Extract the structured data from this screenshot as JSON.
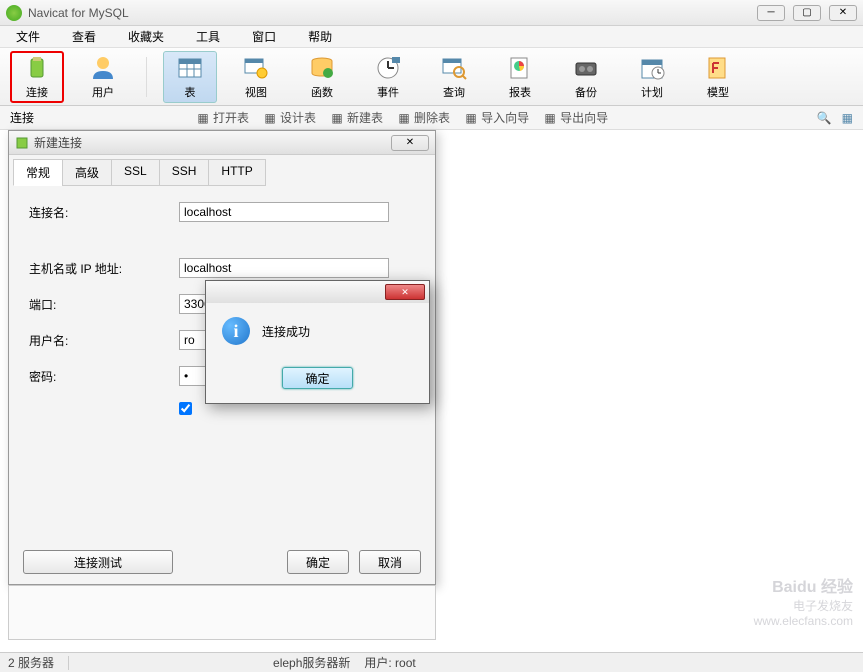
{
  "window": {
    "title": "Navicat for MySQL"
  },
  "menu": {
    "file": "文件",
    "view": "查看",
    "favorites": "收藏夹",
    "tools": "工具",
    "window": "窗口",
    "help": "帮助"
  },
  "toolbar": {
    "connection": "连接",
    "user": "用户",
    "table": "表",
    "view": "视图",
    "function": "函数",
    "event": "事件",
    "query": "查询",
    "report": "报表",
    "backup": "备份",
    "schedule": "计划",
    "model": "模型"
  },
  "secondbar": {
    "connection_label": "连接",
    "open_table": "打开表",
    "design_table": "设计表",
    "new_table": "新建表",
    "delete_table": "删除表",
    "import_wizard": "导入向导",
    "export_wizard": "导出向导"
  },
  "dialog": {
    "title": "新建连接",
    "tabs": {
      "general": "常规",
      "advanced": "高级",
      "ssl": "SSL",
      "ssh": "SSH",
      "http": "HTTP"
    },
    "fields": {
      "conn_name_label": "连接名:",
      "conn_name_value": "localhost",
      "host_label": "主机名或 IP 地址:",
      "host_value": "localhost",
      "port_label": "端口:",
      "port_value": "3306",
      "user_label": "用户名:",
      "user_value": "ro",
      "password_label": "密码:",
      "password_value": "•"
    },
    "buttons": {
      "test": "连接测试",
      "ok": "确定",
      "cancel": "取消"
    }
  },
  "msgbox": {
    "text": "连接成功",
    "ok": "确定"
  },
  "statusbar": {
    "servers": "2 服务器",
    "server_name": "eleph服务器新",
    "user_label": "用户: root"
  },
  "watermark": {
    "line2": "www.elecfans.com"
  }
}
